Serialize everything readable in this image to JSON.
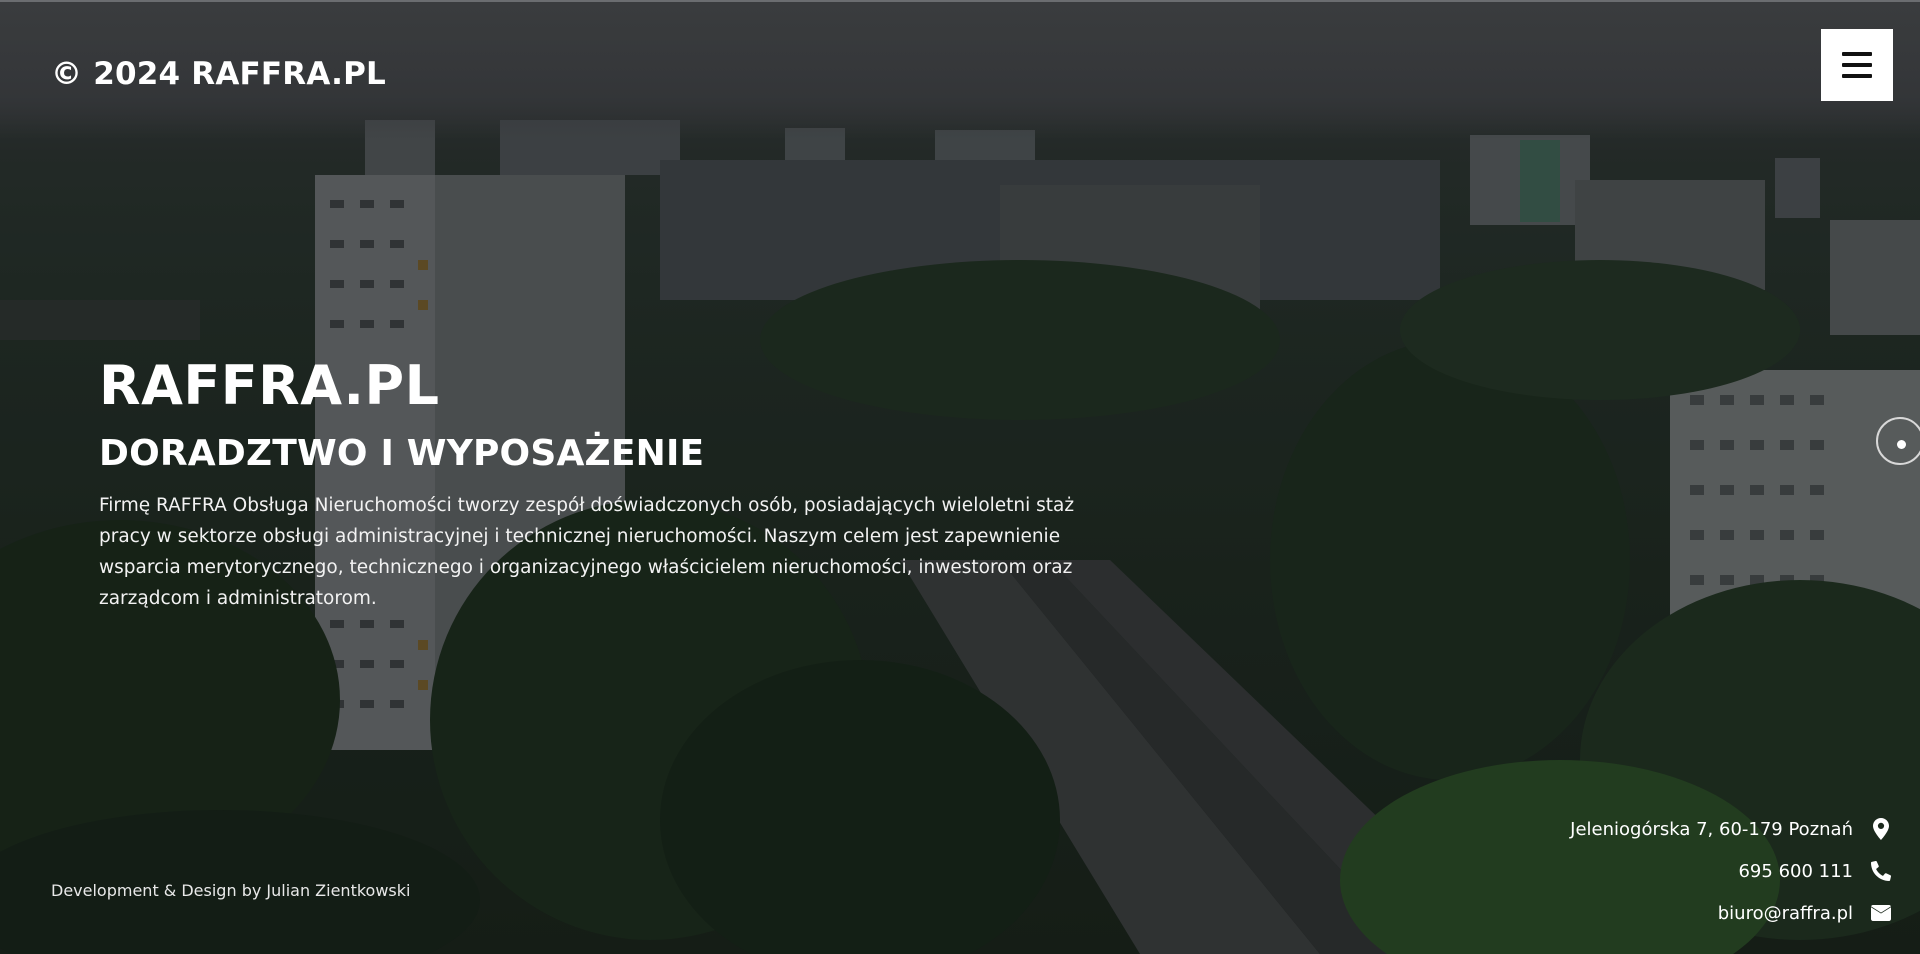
{
  "header": {
    "copyright": "© 2024 RAFFRA.PL",
    "menu_icon": "hamburger-menu-icon"
  },
  "hero": {
    "title": "RAFFRA.PL",
    "subtitle": "DORADZTWO I WYPOSAŻENIE",
    "description": "Firmę RAFFRA Obsługa Nieruchomości tworzy zespół doświadczonych osób, posiadających wieloletni staż pracy w sektorze obsługi administracyjnej i technicznej nieruchomości. Naszym celem jest zapewnienie wsparcia merytorycznego, technicznego i organizacyjnego właścicielem nieruchomości, inwestorom oraz zarządcom i administratorom."
  },
  "footer": {
    "credit": "Development & Design by Julian Zientkowski",
    "contact": {
      "address": "Jeleniogórska 7, 60-179 Poznań",
      "address_icon": "map-marker-icon",
      "phone": "695 600 111",
      "phone_icon": "phone-icon",
      "email": "biuro@raffra.pl",
      "email_icon": "envelope-icon"
    }
  },
  "colors": {
    "text": "#ffffff",
    "menu_button_bg": "#ffffff",
    "menu_icon": "#111111"
  }
}
